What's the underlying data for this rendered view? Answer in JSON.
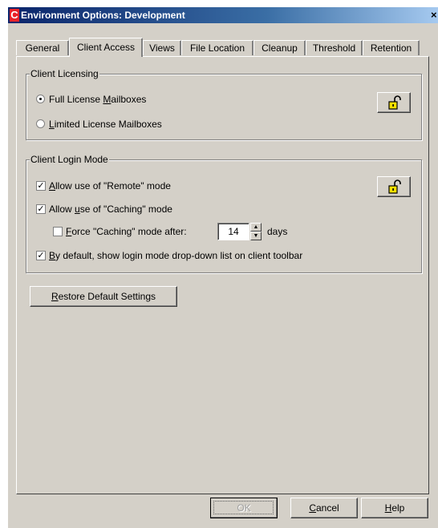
{
  "window": {
    "title": "Environment Options: Development",
    "app_icon_letter": "C",
    "close_glyph": "×"
  },
  "tabs": [
    {
      "label": "General",
      "active": false
    },
    {
      "label": "Client Access",
      "active": true
    },
    {
      "label": "Views",
      "active": false
    },
    {
      "label": "File Location",
      "active": false
    },
    {
      "label": "Cleanup",
      "active": false
    },
    {
      "label": "Threshold",
      "active": false
    },
    {
      "label": "Retention",
      "active": false
    }
  ],
  "client_licensing": {
    "group_label": "Client Licensing",
    "options": [
      {
        "label_pre": "Full License ",
        "mnemonic": "M",
        "label_post": "ailboxes",
        "selected": true
      },
      {
        "label_pre": "",
        "mnemonic": "L",
        "label_post": "imited License Mailboxes",
        "selected": false
      }
    ],
    "lock_icon": "unlocked-padlock-icon"
  },
  "client_login_mode": {
    "group_label": "Client Login Mode",
    "allow_remote": {
      "label_pre": "",
      "mnemonic": "A",
      "label_post": "llow use of \"Remote\" mode",
      "checked": true
    },
    "allow_caching": {
      "label_pre": "Allow ",
      "mnemonic": "u",
      "label_post": "se of \"Caching\" mode",
      "checked": true
    },
    "force_caching": {
      "label_pre": "",
      "mnemonic": "F",
      "label_post": "orce  \"Caching\" mode after:",
      "checked": false,
      "value": "14",
      "unit": "days"
    },
    "show_dropdown": {
      "label_pre": "",
      "mnemonic": "B",
      "label_post": "y default, show login mode drop-down list on client toolbar",
      "checked": true
    },
    "lock_icon": "unlocked-padlock-icon",
    "check_glyph": "✓"
  },
  "restore_button": {
    "label_pre": "",
    "mnemonic": "R",
    "label_post": "estore Default Settings"
  },
  "footer": {
    "ok": {
      "label": "OK",
      "enabled": false
    },
    "cancel": {
      "label_pre": "",
      "mnemonic": "C",
      "label_post": "ancel"
    },
    "help": {
      "label_pre": "",
      "mnemonic": "H",
      "label_post": "elp"
    }
  },
  "colors": {
    "face": "#d4d0c8",
    "title_start": "#0a246a",
    "lock_yellow": "#f5e000"
  }
}
